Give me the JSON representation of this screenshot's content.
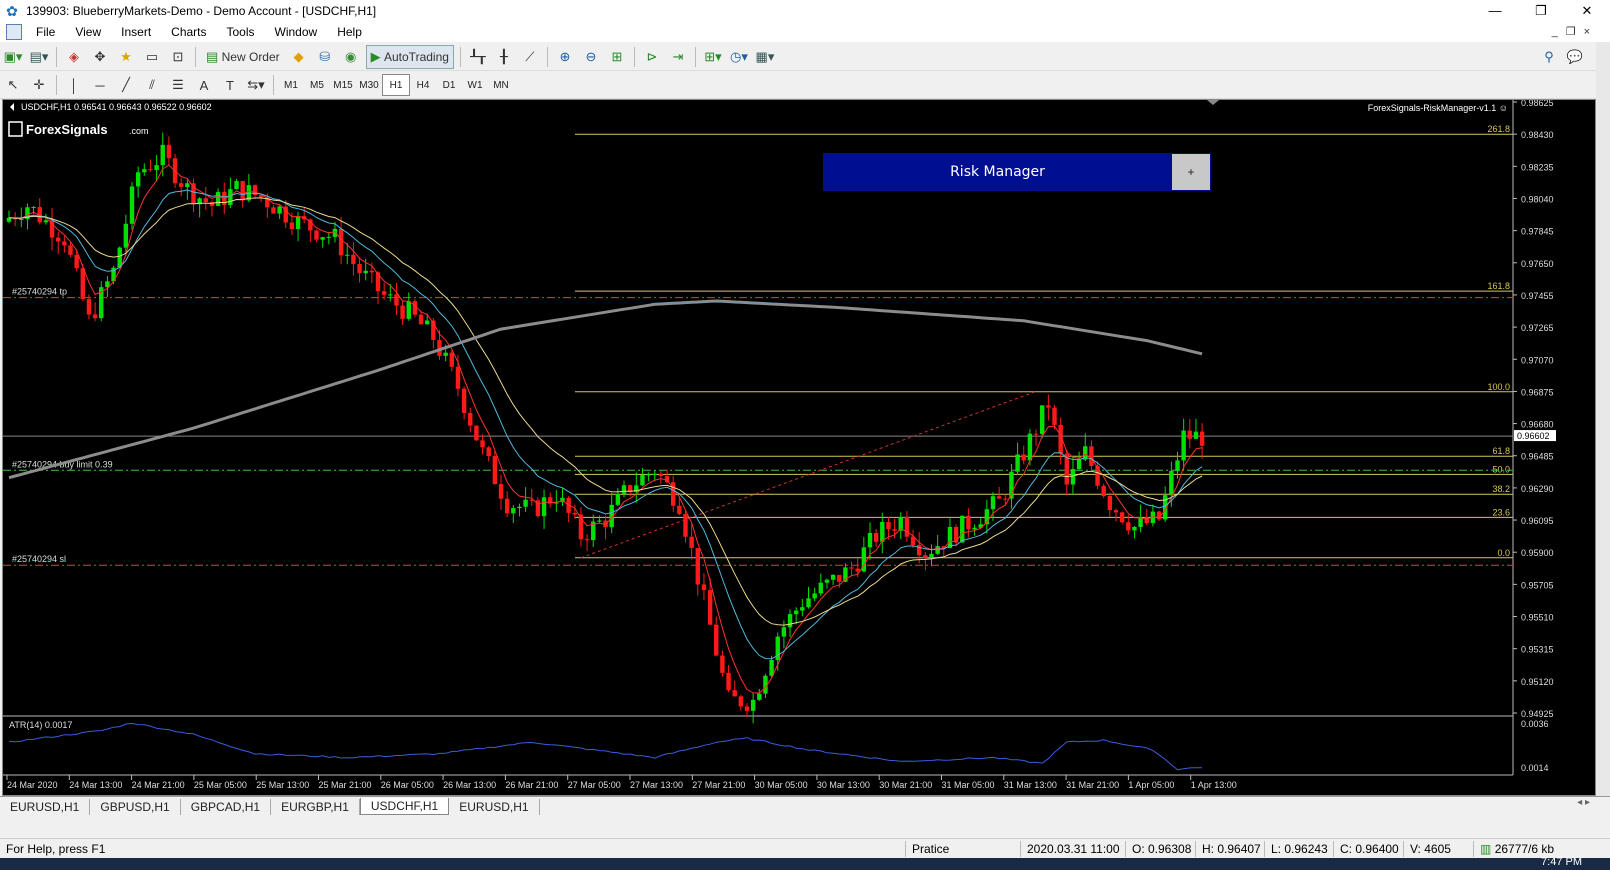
{
  "window": {
    "title": "139903: BlueberryMarkets-Demo - Demo Account - [USDCHF,H1]",
    "controls": [
      "—",
      "❐",
      "✕"
    ]
  },
  "menu": {
    "items": [
      "File",
      "View",
      "Insert",
      "Charts",
      "Tools",
      "Window",
      "Help"
    ],
    "mdi_controls": [
      "_",
      "❐",
      "×"
    ]
  },
  "toolbar": {
    "new_order_label": "New Order",
    "autotrading_label": "AutoTrading"
  },
  "timeframes": [
    "M1",
    "M5",
    "M15",
    "M30",
    "H1",
    "H4",
    "D1",
    "W1",
    "MN"
  ],
  "active_timeframe": "H1",
  "chart": {
    "header": "USDCHF,H1  0.96541 0.96643 0.96522 0.96602",
    "logo_text": "ForexSignals",
    "logo_suffix": ".com",
    "ea_label": "ForexSignals-RiskManager-v1.1 ☺",
    "current_price_label": "0.96602",
    "price_axis": [
      "0.98625",
      "0.98430",
      "0.98235",
      "0.98040",
      "0.97845",
      "0.97650",
      "0.97455",
      "0.97265",
      "0.97070",
      "0.96875",
      "0.96680",
      "0.96485",
      "0.96290",
      "0.96095",
      "0.95900",
      "0.95705",
      "0.95510",
      "0.95315",
      "0.95120",
      "0.94925"
    ],
    "time_axis": [
      "24 Mar 2020",
      "24 Mar 13:00",
      "24 Mar 21:00",
      "25 Mar 05:00",
      "25 Mar 13:00",
      "25 Mar 21:00",
      "26 Mar 05:00",
      "26 Mar 13:00",
      "26 Mar 21:00",
      "27 Mar 05:00",
      "27 Mar 13:00",
      "27 Mar 21:00",
      "30 Mar 05:00",
      "30 Mar 13:00",
      "30 Mar 21:00",
      "31 Mar 05:00",
      "31 Mar 13:00",
      "31 Mar 21:00",
      "1 Apr 05:00",
      "1 Apr 13:00"
    ],
    "fib_levels": [
      {
        "label": "261.8",
        "price": 0.9843
      },
      {
        "label": "161.8",
        "price": 0.9748
      },
      {
        "label": "100.0",
        "price": 0.9687
      },
      {
        "label": "61.8",
        "price": 0.9648
      },
      {
        "label": "50.0",
        "price": 0.9637
      },
      {
        "label": "38.2",
        "price": 0.9625
      },
      {
        "label": "23.6",
        "price": 0.9611
      },
      {
        "label": "0.0",
        "price": 0.95865
      }
    ],
    "order_lines": [
      {
        "label": "#25740294 tp",
        "price": 0.9744,
        "color": "#ff3030"
      },
      {
        "label": "#25740294 buy limit 0.39",
        "price": 0.96395,
        "color": "#40c040"
      },
      {
        "label": "#25740294 sl",
        "price": 0.9582,
        "color": "#ff3030"
      }
    ],
    "atr_label": "ATR(14) 0.0017",
    "atr_axis": [
      "0.0036",
      "0.0014"
    ],
    "colors": {
      "bull": "#00e000",
      "bear": "#ff1a1a",
      "grid_fib": "#d6c85a",
      "ma_gray": "#8c8c8c",
      "ma_red": "#ff3030",
      "ma_cyan": "#4fb8d8",
      "ma_yellow": "#e8d890",
      "atr": "#3a5ce0"
    }
  },
  "risk_manager": {
    "title": "Risk Manager",
    "button": "+"
  },
  "tabs": [
    "EURUSD,H1",
    "GBPUSD,H1",
    "GBPCAD,H1",
    "EURGBP,H1",
    "USDCHF,H1",
    "EURUSD,H1"
  ],
  "active_tab": 4,
  "status": {
    "help": "For Help, press F1",
    "profile": "Pratice",
    "datetime": "2020.03.31 11:00",
    "open": "O: 0.96308",
    "high": "H: 0.96407",
    "low": "L: 0.96243",
    "close": "C: 0.96400",
    "volume": "V: 4605",
    "traffic": "26777/6 kb"
  },
  "taskbar": {
    "clock": "7:47 PM"
  }
}
